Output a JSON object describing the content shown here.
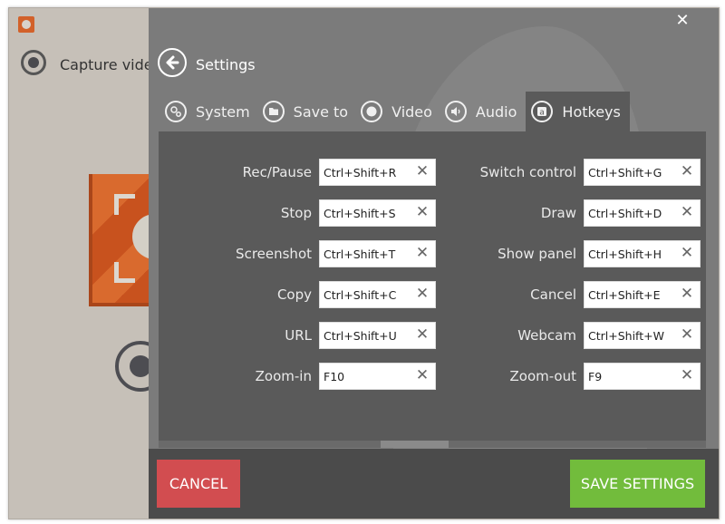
{
  "main_window": {
    "capture_label": "Capture video"
  },
  "settings": {
    "title": "Settings",
    "close_symbol": "✕",
    "tabs": [
      {
        "label": "System",
        "icon": "gears-icon"
      },
      {
        "label": "Save to",
        "icon": "folder-icon"
      },
      {
        "label": "Video",
        "icon": "record-icon"
      },
      {
        "label": "Audio",
        "icon": "speaker-icon"
      },
      {
        "label": "Hotkeys",
        "icon": "keyboard-key-icon",
        "active": true
      }
    ],
    "hotkeys_left": [
      {
        "label": "Rec/Pause",
        "value": "Ctrl+Shift+R"
      },
      {
        "label": "Stop",
        "value": "Ctrl+Shift+S"
      },
      {
        "label": "Screenshot",
        "value": "Ctrl+Shift+T"
      },
      {
        "label": "Copy",
        "value": "Ctrl+Shift+C"
      },
      {
        "label": "URL",
        "value": "Ctrl+Shift+U"
      },
      {
        "label": "Zoom-in",
        "value": "F10"
      }
    ],
    "hotkeys_right": [
      {
        "label": "Switch control",
        "value": "Ctrl+Shift+G"
      },
      {
        "label": "Draw",
        "value": "Ctrl+Shift+D"
      },
      {
        "label": "Show panel",
        "value": "Ctrl+Shift+H"
      },
      {
        "label": "Cancel",
        "value": "Ctrl+Shift+E"
      },
      {
        "label": "Webcam",
        "value": "Ctrl+Shift+W"
      },
      {
        "label": "Zoom-out",
        "value": "F9"
      }
    ],
    "clear_symbol": "✕",
    "footer": {
      "cancel_label": "CANCEL",
      "save_label": "SAVE SETTINGS"
    }
  },
  "colors": {
    "cancel": "#d24d50",
    "save": "#72bc3c",
    "brand_orange": "#d96a2e"
  }
}
